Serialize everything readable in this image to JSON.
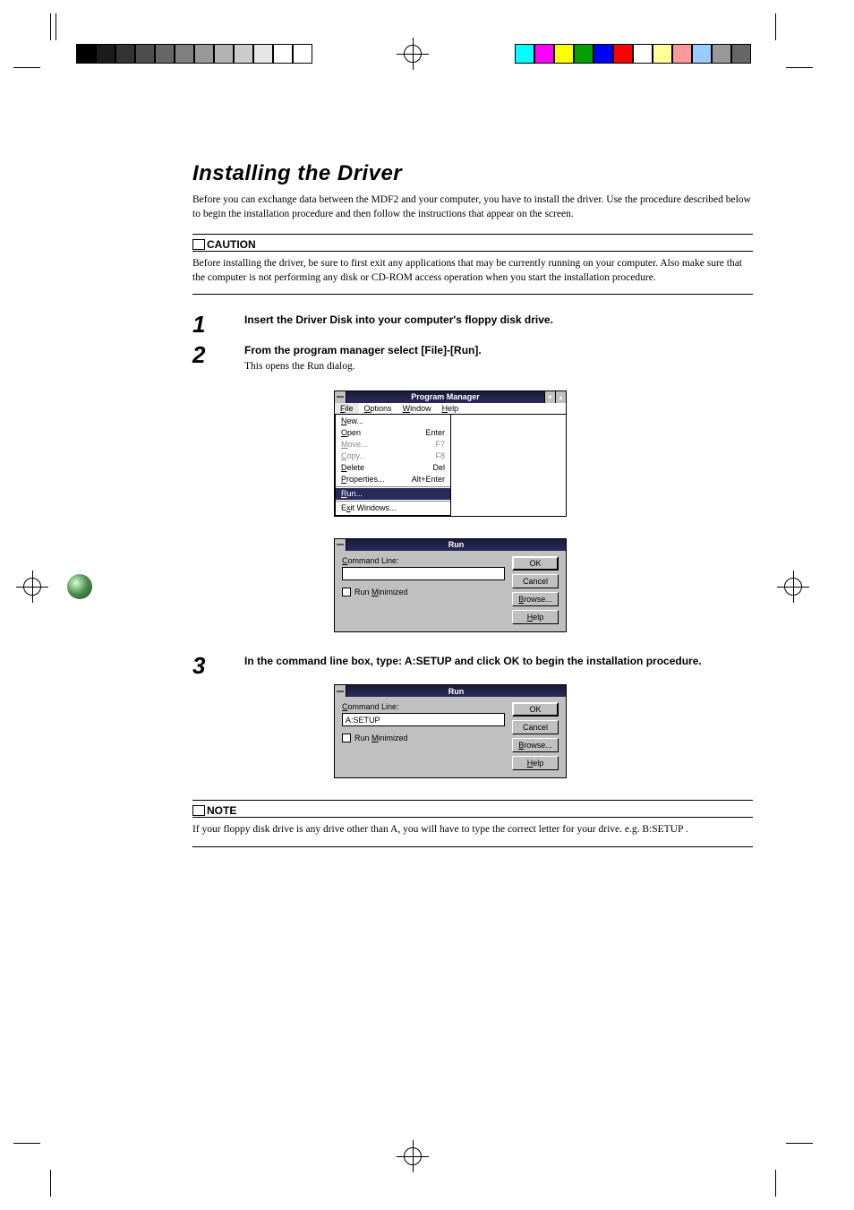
{
  "swatches_left": [
    "#000000",
    "#1a1a1a",
    "#333333",
    "#4d4d4d",
    "#666666",
    "#808080",
    "#999999",
    "#b3b3b3",
    "#cccccc",
    "#e6e6e6",
    "#ffffff",
    "#ffffff"
  ],
  "swatches_right": [
    "#00ffff",
    "#ff00ff",
    "#ffff00",
    "#00a000",
    "#0000ff",
    "#ff0000",
    "#ffffff",
    "#ffff99",
    "#ff9999",
    "#99ccff",
    "#999999",
    "#666666"
  ],
  "page": {
    "title": "Installing the Driver",
    "intro": "Before you can exchange data between the MDF2 and your computer, you have to install the driver. Use the procedure described below to begin the installation procedure and then follow the instructions that appear on the screen."
  },
  "caution": {
    "label": "CAUTION",
    "body": "Before installing the driver, be sure to first exit any applications that may be currently running on your computer. Also make sure that the computer is not performing any disk or CD-ROM access operation when you start the installation procedure."
  },
  "steps": [
    {
      "num": "1",
      "title": "Insert the Driver Disk into your computer's floppy disk drive."
    },
    {
      "num": "2",
      "title": "From the program manager select [File]-[Run].",
      "body": "This opens the Run dialog."
    },
    {
      "num": "3",
      "title": "In the command line box, type: A:SETUP and click OK to begin the installation procedure."
    }
  ],
  "note": {
    "label": "NOTE",
    "body": "If your floppy disk drive is any drive other than A, you will have to type the correct letter for your drive.  e.g. B:SETUP ."
  },
  "pm": {
    "title": "Program Manager",
    "menubar": [
      "File",
      "Options",
      "Window",
      "Help"
    ],
    "file_menu": [
      {
        "label": "New...",
        "sc": ""
      },
      {
        "label": "Open",
        "sc": "Enter"
      },
      {
        "label": "Move...",
        "sc": "F7",
        "disabled": true
      },
      {
        "label": "Copy...",
        "sc": "F8",
        "disabled": true
      },
      {
        "label": "Delete",
        "sc": "Del"
      },
      {
        "label": "Properties...",
        "sc": "Alt+Enter"
      }
    ],
    "file_menu_2": [
      {
        "label": "Run...",
        "sc": "",
        "sel": true
      }
    ],
    "file_menu_3": [
      {
        "label": "Exit Windows...",
        "sc": ""
      }
    ]
  },
  "run1": {
    "title": "Run",
    "cmd_label": "Command Line:",
    "value": "",
    "check": "Run Minimized",
    "btns": [
      "OK",
      "Cancel",
      "Browse...",
      "Help"
    ]
  },
  "run2": {
    "title": "Run",
    "cmd_label": "Command Line:",
    "value": "A:SETUP",
    "check": "Run Minimized",
    "btns": [
      "OK",
      "Cancel",
      "Browse...",
      "Help"
    ]
  }
}
